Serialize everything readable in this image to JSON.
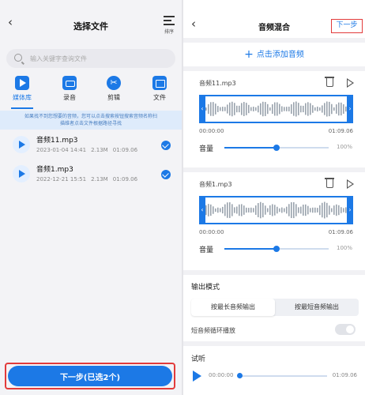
{
  "select_screen": {
    "title": "选择文件",
    "sort_label": "排序",
    "search_placeholder": "输入关键字查询文件",
    "categories": [
      {
        "label": "媒体库",
        "icon": "play-icon",
        "active": true
      },
      {
        "label": "录音",
        "icon": "radio-icon",
        "active": false
      },
      {
        "label": "剪辑",
        "icon": "scissors-icon",
        "active": false
      },
      {
        "label": "文件",
        "icon": "folder-icon",
        "active": false
      }
    ],
    "notice_line1": "如果找不到您想要的音频，您可以点击搜索按钮搜索音频名称扫",
    "notice_line2": "描维者点击文件根据路径寻找",
    "files": [
      {
        "name": "音频11.mp3",
        "date": "2023-01-04 14:41",
        "size": "2.13M",
        "duration": "01:09.06",
        "checked": true
      },
      {
        "name": "音频1.mp3",
        "date": "2022-12-21 15:51",
        "size": "2.13M",
        "duration": "01:09.06",
        "checked": true
      }
    ],
    "next_button": "下一步(已选2个)"
  },
  "mix_screen": {
    "title": "音频混合",
    "next_button": "下一步",
    "add_audio": "点击添加音频",
    "tracks": [
      {
        "name": "音频11.mp3",
        "start_time": "00:00:00",
        "end_time": "01:09.06",
        "volume_label": "音量",
        "volume_pct": "100%",
        "volume_value": 0.5
      },
      {
        "name": "音频1.mp3",
        "start_time": "00:00:00",
        "end_time": "01:09.06",
        "volume_label": "音量",
        "volume_pct": "100%",
        "volume_value": 0.5
      }
    ],
    "output_mode_label": "输出模式",
    "output_options": [
      "按最长音频输出",
      "按最短音频输出"
    ],
    "output_selected": "按最长音频输出",
    "loop_label": "短音频循环播放",
    "loop_enabled": false,
    "preview_label": "试听",
    "preview_start": "00:00:00",
    "preview_end": "01:09.06",
    "preview_progress": 0
  },
  "colors": {
    "accent": "#1c79e6",
    "highlight": "#e23b3b"
  }
}
